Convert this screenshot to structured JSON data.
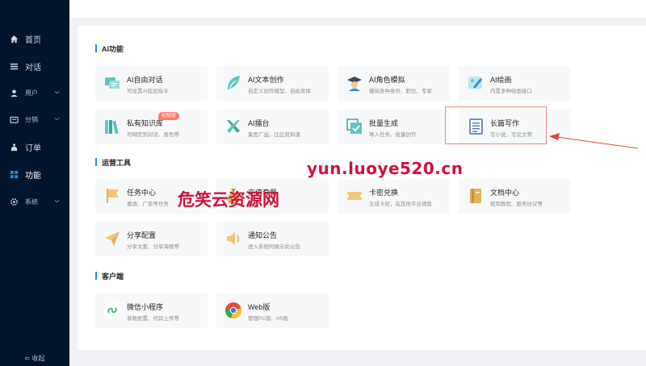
{
  "sidebar": {
    "items": [
      {
        "label": "首页",
        "icon": "home-icon"
      },
      {
        "label": "对话",
        "icon": "list-icon"
      },
      {
        "label": "用户",
        "icon": "user-icon"
      },
      {
        "label": "分销",
        "icon": "wallet-icon"
      },
      {
        "label": "订单",
        "icon": "bag-icon"
      },
      {
        "label": "功能",
        "icon": "apps-icon"
      },
      {
        "label": "系统",
        "icon": "gear-icon"
      }
    ],
    "collapse_label": "⇐ 收起"
  },
  "sections": [
    {
      "title": "AI功能",
      "cards": [
        {
          "title": "AI自由对话",
          "desc": "可设置AI底层指令"
        },
        {
          "title": "AI文本创作",
          "desc": "自定义创作模型，自由发挥"
        },
        {
          "title": "AI角色模拟",
          "desc": "模拟各种身份、职位、专家"
        },
        {
          "title": "AI绘画",
          "desc": "内置多种绘画接口"
        },
        {
          "title": "私有知识库",
          "desc": "可绑定到对话、角色等",
          "badge": "初级版"
        },
        {
          "title": "AI擂台",
          "desc": "集思广益，比比就知道"
        },
        {
          "title": "批量生成",
          "desc": "导入任务，批量创作"
        },
        {
          "title": "长篇写作",
          "desc": "写小说、写论文等"
        }
      ]
    },
    {
      "title": "运营工具",
      "cards": [
        {
          "title": "任务中心",
          "desc": "邀请、广告等任务"
        },
        {
          "title": "充值套餐",
          "desc": "充值"
        },
        {
          "title": "卡密兑换",
          "desc": "生成卡密，在其他平台销售"
        },
        {
          "title": "文档中心",
          "desc": "使用教程、服务协议等"
        },
        {
          "title": "分享配置",
          "desc": "分享文案、分享海报等"
        },
        {
          "title": "通知公告",
          "desc": "进入系统时展示此公告"
        }
      ]
    },
    {
      "title": "客户端",
      "cards": [
        {
          "title": "微信小程序",
          "desc": "参数配置、代码上传等"
        },
        {
          "title": "Web版",
          "desc": "管理PC版、H5版"
        }
      ]
    }
  ],
  "watermark": {
    "url": "yun.luoye520.cn",
    "text": "危笑云资源网"
  },
  "colors": {
    "sidebar_bg": "#001529",
    "accent": "#1890ff",
    "watermark": "#d0123a",
    "highlight": "#f08a82"
  }
}
